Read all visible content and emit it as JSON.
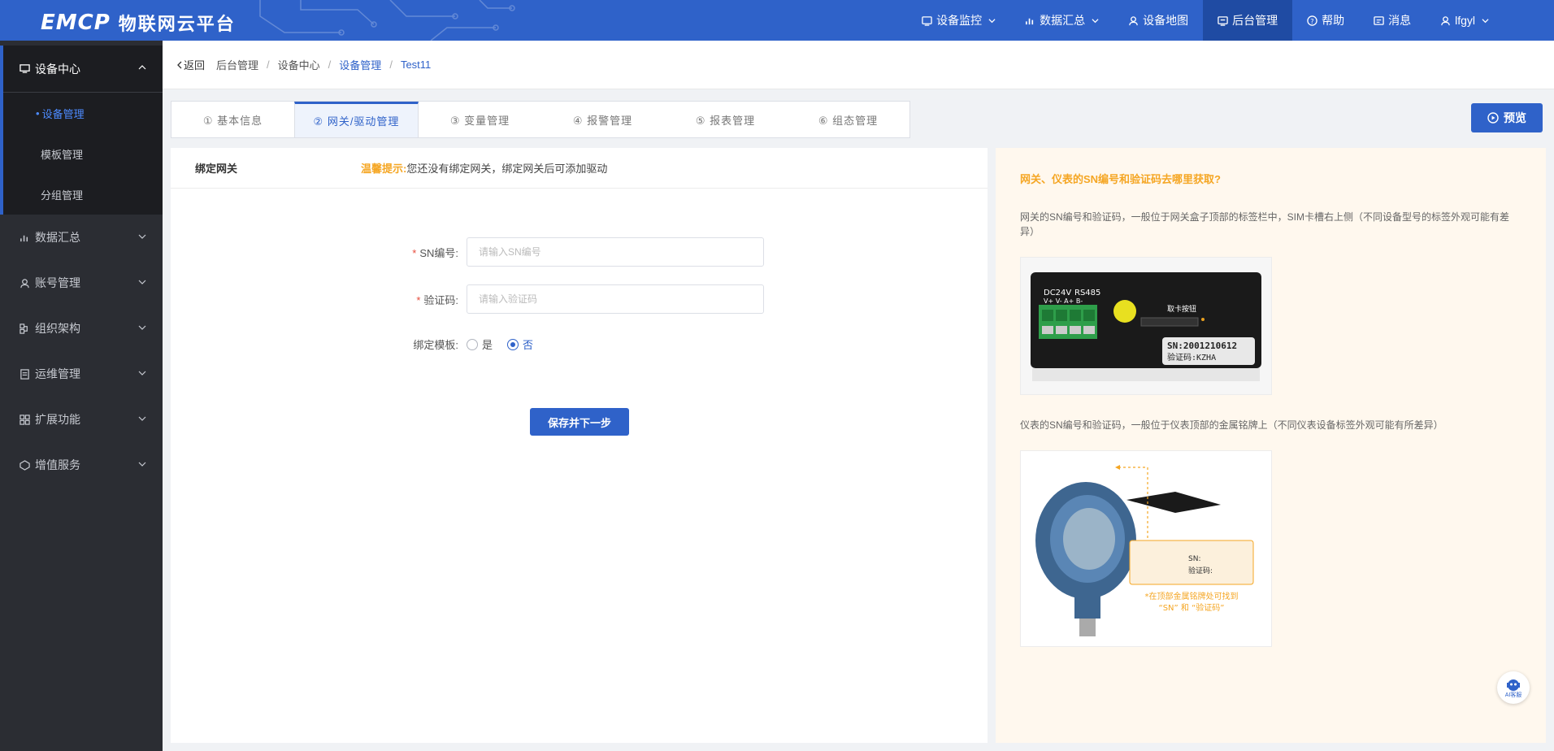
{
  "header": {
    "brand": "EMCP",
    "platform_name": "物联网云平台",
    "nav": [
      {
        "label": "设备监控",
        "icon": "monitor-icon",
        "dropdown": true
      },
      {
        "label": "数据汇总",
        "icon": "chart-icon",
        "dropdown": true
      },
      {
        "label": "设备地图",
        "icon": "map-user-icon",
        "dropdown": false
      },
      {
        "label": "后台管理",
        "icon": "admin-icon",
        "dropdown": false,
        "active": true
      },
      {
        "label": "帮助",
        "icon": "help-icon",
        "dropdown": false
      },
      {
        "label": "消息",
        "icon": "message-icon",
        "dropdown": false
      },
      {
        "label": "lfgyl",
        "icon": "user-icon",
        "dropdown": true
      }
    ],
    "color": "#2f62c9"
  },
  "sidebar": {
    "groups": [
      {
        "label": "设备中心",
        "icon": "device-icon",
        "open": true,
        "items": [
          {
            "label": "设备管理",
            "active": true
          },
          {
            "label": "模板管理"
          },
          {
            "label": "分组管理"
          }
        ]
      },
      {
        "label": "数据汇总",
        "icon": "chart-icon"
      },
      {
        "label": "账号管理",
        "icon": "user-icon"
      },
      {
        "label": "组织架构",
        "icon": "org-icon"
      },
      {
        "label": "运维管理",
        "icon": "ops-icon"
      },
      {
        "label": "扩展功能",
        "icon": "extend-icon"
      },
      {
        "label": "增值服务",
        "icon": "vas-icon"
      }
    ]
  },
  "breadcrumb": {
    "back": "返回",
    "items": [
      "后台管理",
      "设备中心",
      "设备管理",
      "Test11"
    ]
  },
  "tabs": [
    {
      "label": "① 基本信息"
    },
    {
      "label": "② 网关/驱动管理",
      "active": true
    },
    {
      "label": "③ 变量管理"
    },
    {
      "label": "④ 报警管理"
    },
    {
      "label": "⑤ 报表管理"
    },
    {
      "label": "⑥ 组态管理"
    }
  ],
  "preview_button": "预览",
  "form": {
    "title": "绑定网关",
    "hint_label": "温馨提示:",
    "hint_text": "您还没有绑定网关，绑定网关后可添加驱动",
    "sn": {
      "label": "SN编号:",
      "placeholder": "请输入SN编号",
      "value": ""
    },
    "code": {
      "label": "验证码:",
      "placeholder": "请输入验证码",
      "value": ""
    },
    "bind_template": {
      "label": "绑定模板:",
      "options": [
        "是",
        "否"
      ],
      "selected": "否"
    },
    "save_label": "保存并下一步"
  },
  "help": {
    "title": "网关、仪表的SN编号和验证码去哪里获取?",
    "gateway_text": "网关的SN编号和验证码，一般位于网关盒子顶部的标签栏中，SIM卡槽右上侧（不同设备型号的标签外观可能有差异）",
    "meter_text": "仪表的SN编号和验证码，一般位于仪表顶部的金属铭牌上（不同仪表设备标签外观可能有所差异）",
    "gateway_img": {
      "dc_label": "DC24V",
      "rs_label": "RS485",
      "pins": "V+ V- A+ B-",
      "card_btn": "取卡按钮",
      "sn_line": "SN:2001210612",
      "code_line": "验证码:KZHA"
    },
    "meter_img": {
      "plate_sn": "SN:",
      "plate_code": "验证码:",
      "caption1": "*在顶部金属铭牌处可找到",
      "caption2": "“SN” 和 “验证码”"
    }
  },
  "ai_assistant": "AI客服"
}
